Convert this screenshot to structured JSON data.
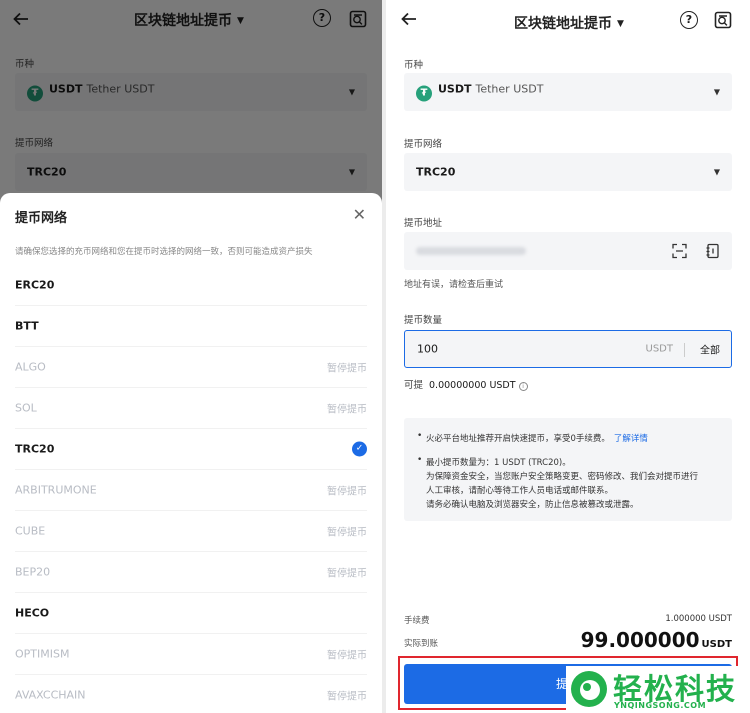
{
  "header": {
    "title": "区块链地址提币"
  },
  "form": {
    "currency_label": "币种",
    "currency_symbol": "USDT",
    "currency_name": "Tether USDT",
    "network_label": "提币网络",
    "network_value": "TRC20",
    "address_label": "提币地址",
    "address_error": "地址有误，请检查后重试",
    "amount_label": "提币数量",
    "amount_value": "100",
    "amount_unit": "USDT",
    "all_label": "全部",
    "available_label": "可提",
    "available_value": "0.00000000 USDT"
  },
  "notice": {
    "line1": "火必平台地址推荐开启快速提币，享受0手续费。",
    "line1_link": "了解详情",
    "line2": "最小提币数量为：1 USDT (TRC20)。",
    "line3": "为保障资金安全，当您账户安全策略变更、密码修改、我们会对提币进行",
    "line4": "人工审核，请耐心等待工作人员电话或邮件联系。",
    "line5": "请务必确认电脑及浏览器安全，防止信息被篡改或泄露。"
  },
  "footer": {
    "fee_label": "手续费",
    "fee_value": "1.000000 USDT",
    "receive_label": "实际到账",
    "receive_value": "99.000000",
    "receive_unit": "USDT",
    "submit_label": "提币"
  },
  "sheet": {
    "title": "提币网络",
    "hint": "请确保您选择的充币网络和您在提币时选择的网络一致，否则可能造成资产损失",
    "networks": [
      {
        "name": "ERC20",
        "status": ""
      },
      {
        "name": "BTT",
        "status": ""
      },
      {
        "name": "ALGO",
        "status": "暂停提币"
      },
      {
        "name": "SOL",
        "status": "暂停提币"
      },
      {
        "name": "TRC20",
        "status": ""
      },
      {
        "name": "ARBITRUMONE",
        "status": "暂停提币"
      },
      {
        "name": "CUBE",
        "status": "暂停提币"
      },
      {
        "name": "BEP20",
        "status": "暂停提币"
      },
      {
        "name": "HECO",
        "status": ""
      },
      {
        "name": "OPTIMISM",
        "status": "暂停提币"
      },
      {
        "name": "AVAXCCHAIN",
        "status": "暂停提币"
      }
    ]
  },
  "watermark": {
    "title": "轻松科技",
    "url": "YNQINGSONG.COM"
  },
  "colors": {
    "accent": "#1c6be5",
    "tether": "#26a17b",
    "highlight": "#e0262e",
    "watermark": "#23b14d"
  }
}
